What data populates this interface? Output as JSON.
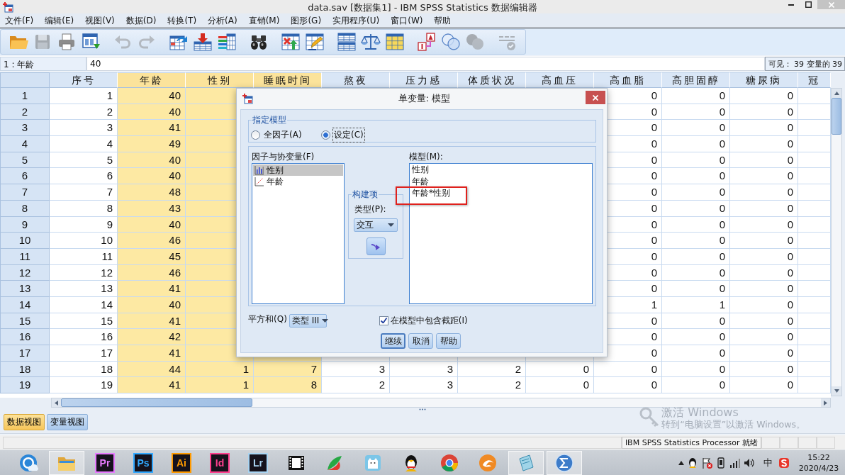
{
  "window": {
    "title": "data.sav [数据集1] - IBM SPSS Statistics 数据编辑器"
  },
  "menu": [
    "文件(F)",
    "编辑(E)",
    "视图(V)",
    "数据(D)",
    "转换(T)",
    "分析(A)",
    "直销(M)",
    "图形(G)",
    "实用程序(U)",
    "窗口(W)",
    "帮助"
  ],
  "toolbar": [
    [
      {
        "kind": "open",
        "disabled": false
      },
      {
        "kind": "save",
        "disabled": true
      },
      {
        "kind": "print",
        "disabled": false
      },
      {
        "kind": "recall",
        "disabled": false
      }
    ],
    [
      {
        "kind": "undo",
        "disabled": true
      },
      {
        "kind": "redo",
        "disabled": true
      }
    ],
    [
      {
        "kind": "goto-case",
        "disabled": false
      },
      {
        "kind": "goto-variable",
        "disabled": false
      },
      {
        "kind": "variables",
        "disabled": false
      }
    ],
    [
      {
        "kind": "find",
        "disabled": false
      }
    ],
    [
      {
        "kind": "insert-cases",
        "disabled": false
      },
      {
        "kind": "insert-variable",
        "disabled": false
      }
    ],
    [
      {
        "kind": "split",
        "disabled": false
      },
      {
        "kind": "weight",
        "disabled": false
      },
      {
        "kind": "select",
        "disabled": false
      }
    ],
    [
      {
        "kind": "value-labels",
        "disabled": false
      },
      {
        "kind": "variable-sets",
        "disabled": false
      },
      {
        "kind": "show-all",
        "disabled": true
      }
    ],
    [
      {
        "kind": "spell",
        "disabled": true
      }
    ]
  ],
  "cell_editor": {
    "cell_ref": "1 : 年龄",
    "value": "40",
    "visible_info": "可见： 39 变量的 39"
  },
  "grid": {
    "columns": [
      {
        "label": "序号",
        "highlighted": false
      },
      {
        "label": "年龄",
        "highlighted": true
      },
      {
        "label": "性别",
        "highlighted": true
      },
      {
        "label": "睡眠时间",
        "highlighted": true
      },
      {
        "label": "熬夜",
        "highlighted": false
      },
      {
        "label": "压力感",
        "highlighted": false
      },
      {
        "label": "体质状况",
        "highlighted": false
      },
      {
        "label": "高血压",
        "highlighted": false
      },
      {
        "label": "高血脂",
        "highlighted": false
      },
      {
        "label": "高胆固醇",
        "highlighted": false
      },
      {
        "label": "糖尿病",
        "highlighted": false
      },
      {
        "label": "冠",
        "highlighted": false
      }
    ],
    "rows": [
      {
        "label": "1",
        "cells": [
          "1",
          "40",
          null,
          null,
          null,
          null,
          null,
          null,
          "0",
          "0",
          "0",
          null
        ]
      },
      {
        "label": "2",
        "cells": [
          "2",
          "40",
          null,
          null,
          null,
          null,
          null,
          null,
          "0",
          "0",
          "0",
          null
        ]
      },
      {
        "label": "3",
        "cells": [
          "3",
          "41",
          null,
          null,
          null,
          null,
          null,
          null,
          "0",
          "0",
          "0",
          null
        ]
      },
      {
        "label": "4",
        "cells": [
          "4",
          "49",
          null,
          null,
          null,
          null,
          null,
          null,
          "0",
          "0",
          "0",
          null
        ]
      },
      {
        "label": "5",
        "cells": [
          "5",
          "40",
          null,
          null,
          null,
          null,
          null,
          null,
          "0",
          "0",
          "0",
          null
        ]
      },
      {
        "label": "6",
        "cells": [
          "6",
          "40",
          null,
          null,
          null,
          null,
          null,
          null,
          "0",
          "0",
          "0",
          null
        ]
      },
      {
        "label": "7",
        "cells": [
          "7",
          "48",
          null,
          null,
          null,
          null,
          null,
          null,
          "0",
          "0",
          "0",
          null
        ]
      },
      {
        "label": "8",
        "cells": [
          "8",
          "43",
          null,
          null,
          null,
          null,
          null,
          null,
          "0",
          "0",
          "0",
          null
        ]
      },
      {
        "label": "9",
        "cells": [
          "9",
          "40",
          null,
          null,
          null,
          null,
          null,
          null,
          "0",
          "0",
          "0",
          null
        ]
      },
      {
        "label": "10",
        "cells": [
          "10",
          "46",
          null,
          null,
          null,
          null,
          null,
          null,
          "0",
          "0",
          "0",
          null
        ]
      },
      {
        "label": "11",
        "cells": [
          "11",
          "45",
          null,
          null,
          null,
          null,
          null,
          null,
          "0",
          "0",
          "0",
          null
        ]
      },
      {
        "label": "12",
        "cells": [
          "12",
          "46",
          null,
          null,
          null,
          null,
          null,
          null,
          "0",
          "0",
          "0",
          null
        ]
      },
      {
        "label": "13",
        "cells": [
          "13",
          "41",
          null,
          null,
          null,
          null,
          null,
          null,
          "0",
          "0",
          "0",
          null
        ]
      },
      {
        "label": "14",
        "cells": [
          "14",
          "40",
          null,
          null,
          null,
          null,
          null,
          null,
          "1",
          "1",
          "0",
          null
        ]
      },
      {
        "label": "15",
        "cells": [
          "15",
          "41",
          null,
          null,
          null,
          null,
          null,
          null,
          "0",
          "0",
          "0",
          null
        ]
      },
      {
        "label": "16",
        "cells": [
          "16",
          "42",
          null,
          null,
          null,
          null,
          null,
          null,
          "0",
          "0",
          "0",
          null
        ]
      },
      {
        "label": "17",
        "cells": [
          "17",
          "41",
          null,
          null,
          null,
          null,
          null,
          null,
          "0",
          "0",
          "0",
          null
        ]
      },
      {
        "label": "18",
        "cells": [
          "18",
          "44",
          "1",
          "7",
          "3",
          "3",
          "2",
          "0",
          "0",
          "0",
          "0",
          null
        ]
      },
      {
        "label": "19",
        "cells": [
          "19",
          "41",
          "1",
          "8",
          "2",
          "3",
          "2",
          "0",
          "0",
          "0",
          "0",
          null
        ]
      }
    ]
  },
  "dialog": {
    "title": "单变量: 模型",
    "specify_model": {
      "title": "指定模型",
      "options": [
        {
          "label": "全因子(A)",
          "selected": false
        },
        {
          "label": "设定(C)",
          "selected": true
        }
      ]
    },
    "factors": {
      "label": "因子与协变量(F)",
      "items": [
        {
          "label": "性别",
          "kind": "nominal",
          "selected": true
        },
        {
          "label": "年龄",
          "kind": "scale",
          "selected": false
        }
      ]
    },
    "build_term": {
      "title": "构建项",
      "type_label": "类型(P):",
      "type_value": "交互"
    },
    "model": {
      "label": "模型(M):",
      "items": [
        {
          "label": "性别",
          "highlighted": false
        },
        {
          "label": "年龄",
          "highlighted": false
        },
        {
          "label": "年龄*性别",
          "highlighted": true
        }
      ]
    },
    "sum_of_squares": {
      "label": "平方和(Q)",
      "value": "类型 III"
    },
    "include_intercept": {
      "label": "在模型中包含截距(I)",
      "checked": true
    },
    "buttons": [
      {
        "label": "继续",
        "default": true
      },
      {
        "label": "取消",
        "default": false
      },
      {
        "label": "帮助",
        "default": false
      }
    ]
  },
  "tabs": [
    {
      "label": "数据视图",
      "selected": true
    },
    {
      "label": "变量视图",
      "selected": false
    }
  ],
  "activation_notice": {
    "title": "激活 Windows",
    "text": "转到“电脑设置”以激活 Windows。"
  },
  "status_bar": {
    "text": "IBM SPSS Statistics Processor 就绪"
  },
  "taskbar": {
    "apps": [
      {
        "kind": "round",
        "running": false
      },
      {
        "kind": "folder",
        "running": true
      },
      {
        "kind": "letter",
        "label": "Pr",
        "color": "#e77bff",
        "running": false
      },
      {
        "kind": "letter",
        "label": "Ps",
        "color": "#31a8ff",
        "running": false
      },
      {
        "kind": "letter",
        "label": "Ai",
        "color": "#ff9a00",
        "running": false
      },
      {
        "kind": "letter",
        "label": "Id",
        "color": "#ff3f8e",
        "running": false
      },
      {
        "kind": "letter",
        "label": "Lr",
        "color": "#a9d4f2",
        "running": false
      },
      {
        "kind": "film",
        "running": false
      },
      {
        "kind": "petal",
        "running": false
      },
      {
        "kind": "cat",
        "running": false
      },
      {
        "kind": "penguin",
        "running": false
      },
      {
        "kind": "chrome",
        "running": false
      },
      {
        "kind": "swirl",
        "running": false
      },
      {
        "kind": "notebook",
        "running": true
      },
      {
        "kind": "sigma",
        "running": true
      }
    ],
    "ime": "中",
    "time": "15:22",
    "date": "2020/4/23"
  }
}
